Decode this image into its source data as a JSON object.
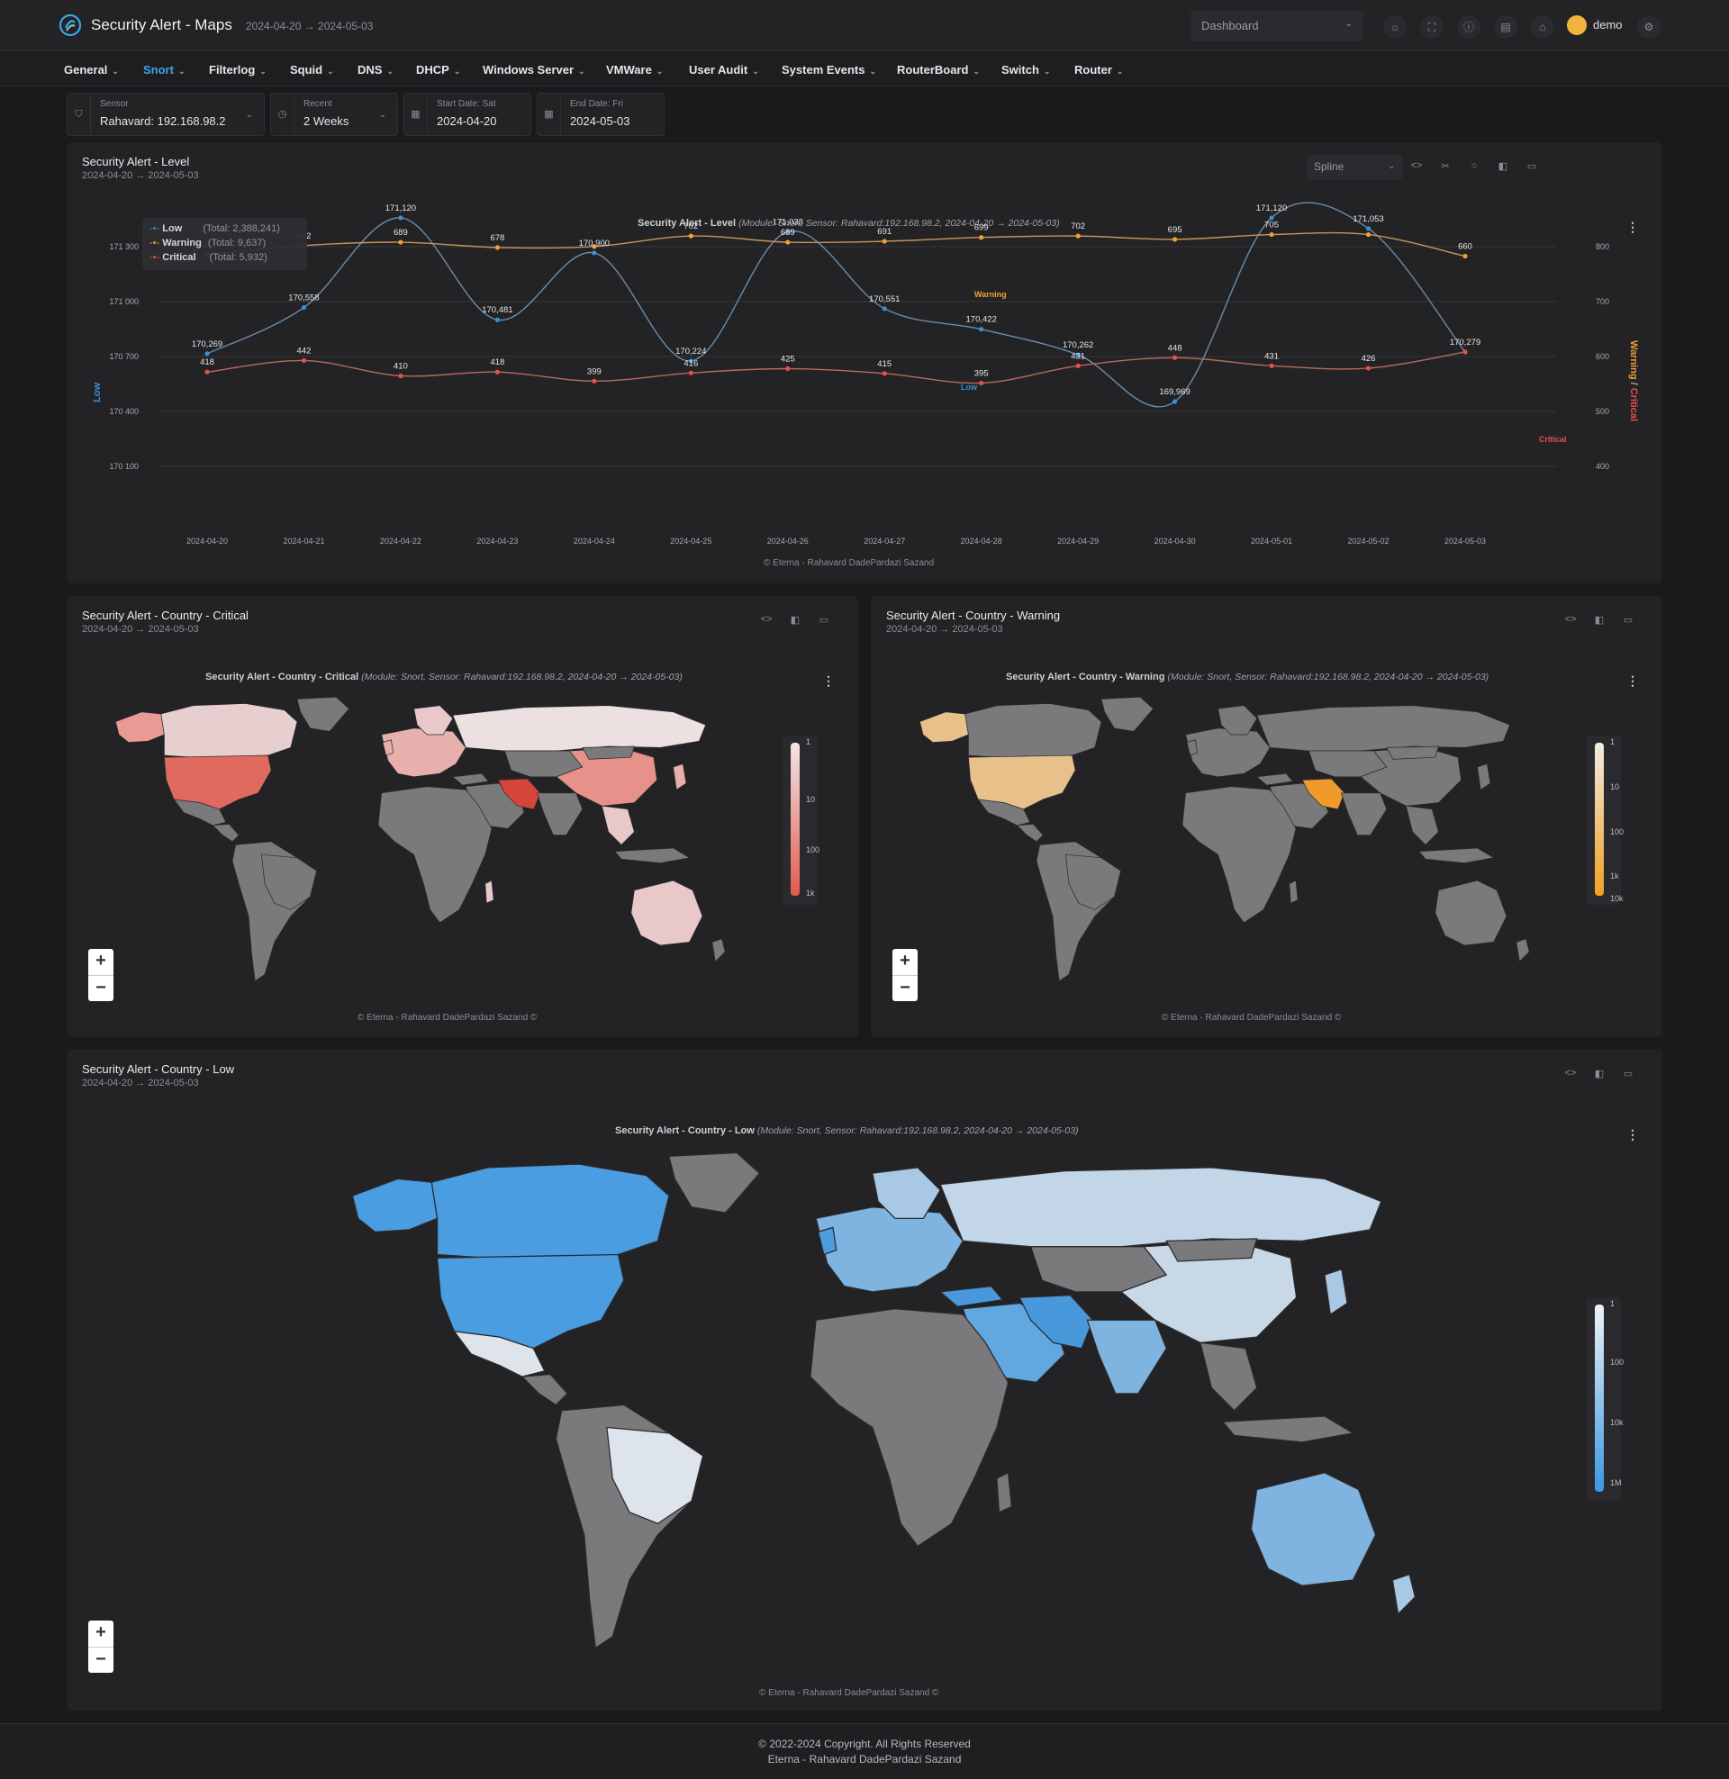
{
  "header": {
    "title": "Security Alert - Maps",
    "range": "2024-04-20 → 2024-05-03",
    "dashboard_select": "Dashboard",
    "user": "demo"
  },
  "nav": [
    {
      "label": "General"
    },
    {
      "label": "Snort"
    },
    {
      "label": "Filterlog"
    },
    {
      "label": "Squid"
    },
    {
      "label": "DNS"
    },
    {
      "label": "DHCP"
    },
    {
      "label": "Windows Server"
    },
    {
      "label": "VMWare"
    },
    {
      "label": "User Audit"
    },
    {
      "label": "System Events"
    },
    {
      "label": "RouterBoard"
    },
    {
      "label": "Switch"
    },
    {
      "label": "Router"
    }
  ],
  "filters": {
    "sensor": {
      "label": "Sensor",
      "value": "Rahavard: 192.168.98.2"
    },
    "recent": {
      "label": "Recent",
      "value": "2 Weeks"
    },
    "start": {
      "label": "Start Date: Sat",
      "value": "2024-04-20"
    },
    "end": {
      "label": "End Date: Fri",
      "value": "2024-05-03"
    }
  },
  "level_panel": {
    "title": "Security Alert - Level",
    "subtitle": "2024-04-20 → 2024-05-03",
    "chart_type_select": "Spline",
    "chart_title_bold": "Security Alert - Level",
    "chart_title_meta": "(Module: Snort, Sensor: Rahavard:192.168.98.2, 2024-04-20 → 2024-05-03)",
    "credit": "© Eterna - Rahavard DadePardazi Sazand"
  },
  "chart_data": {
    "type": "line",
    "title": "Security Alert - Level",
    "subtitle": "(Module: Snort, Sensor: Rahavard:192.168.98.2, 2024-04-20 → 2024-05-03)",
    "x": [
      "2024-04-20",
      "2024-04-21",
      "2024-04-22",
      "2024-04-23",
      "2024-04-24",
      "2024-04-25",
      "2024-04-26",
      "2024-04-27",
      "2024-04-28",
      "2024-04-29",
      "2024-04-30",
      "2024-05-01",
      "2024-05-02",
      "2024-05-03"
    ],
    "ylabel_left": "Low",
    "ylabel_right_a": "Warning",
    "ylabel_right_sep": " / ",
    "ylabel_right_b": "Critical",
    "y_left_ticks": [
      "171 300",
      "171 000",
      "170 700",
      "170 400",
      "170 100"
    ],
    "y_left_range": [
      169800,
      171300
    ],
    "y_right_ticks": [
      "800",
      "700",
      "600",
      "500",
      "400"
    ],
    "y_right_range": [
      300,
      800
    ],
    "series": [
      {
        "name": "Low",
        "total": "(Total: 2,388,241)",
        "color": "#3a8fd4",
        "axis": "left",
        "label": "Low",
        "values": [
          170269,
          170558,
          171120,
          170481,
          170900,
          170224,
          171033,
          170551,
          170422,
          170262,
          169969,
          171120,
          171053,
          170279
        ],
        "labels": [
          "170,269",
          "170,558",
          "171,120",
          "170,481",
          "170,900",
          "170,224",
          "171,033",
          "170,551",
          "170,422",
          "170,262",
          "169,969",
          "171,120",
          "171,053",
          "170,279"
        ]
      },
      {
        "name": "Warning",
        "total": "(Total: 9,637)",
        "color": "#f0a030",
        "axis": "right",
        "label": "Warning",
        "values": [
          663,
          682,
          689,
          678,
          680,
          702,
          689,
          691,
          699,
          702,
          695,
          705,
          705,
          660
        ],
        "labels": [
          "663",
          "682",
          "689",
          "678",
          "",
          "702",
          "689",
          "691",
          "699",
          "702",
          "695",
          "705",
          "",
          "660"
        ]
      },
      {
        "name": "Critical",
        "total": "(Total: 5,932)",
        "color": "#e8504a",
        "axis": "right",
        "label": "Critical",
        "values": [
          418,
          442,
          410,
          418,
          399,
          416,
          425,
          415,
          395,
          431,
          448,
          431,
          426,
          460
        ],
        "labels": [
          "418",
          "442",
          "410",
          "418",
          "399",
          "416",
          "425",
          "415",
          "395",
          "431",
          "448",
          "431",
          "426",
          ""
        ]
      }
    ]
  },
  "map_critical": {
    "title": "Security Alert - Country - Critical",
    "subtitle": "2024-04-20 → 2024-05-03",
    "chart_title_bold": "Security Alert - Country - Critical",
    "chart_title_meta": "(Module: Snort, Sensor: Rahavard:192.168.98.2, 2024-04-20 → 2024-05-03)",
    "legend_ticks": [
      "1",
      "10",
      "100",
      "1k"
    ],
    "legend_colors": [
      "#f2e6e6",
      "#e25a4e"
    ],
    "credit": "© Eterna - Rahavard DadePardazi Sazand ©"
  },
  "map_warning": {
    "title": "Security Alert - Country - Warning",
    "subtitle": "2024-04-20 → 2024-05-03",
    "chart_title_bold": "Security Alert - Country - Warning",
    "chart_title_meta": "(Module: Snort, Sensor: Rahavard:192.168.98.2, 2024-04-20 → 2024-05-03)",
    "legend_ticks": [
      "1",
      "10",
      "100",
      "1k",
      "10k"
    ],
    "legend_colors": [
      "#f2ece4",
      "#f0a020"
    ],
    "credit": "© Eterna - Rahavard DadePardazi Sazand ©"
  },
  "map_low": {
    "title": "Security Alert - Country - Low",
    "subtitle": "2024-04-20 → 2024-05-03",
    "chart_title_bold": "Security Alert - Country - Low",
    "chart_title_meta": "(Module: Snort, Sensor: Rahavard:192.168.98.2, 2024-04-20 → 2024-05-03)",
    "legend_ticks": [
      "1",
      "100",
      "10k",
      "1M"
    ],
    "legend_colors": [
      "#eef2f6",
      "#3a98e0"
    ],
    "credit": "© Eterna - Rahavard DadePardazi Sazand ©"
  },
  "footer": {
    "line1": "© 2022-2024 Copyright. All Rights Reserved",
    "line2": "Eterna - Rahavard DadePardazi Sazand"
  },
  "colors": {
    "land": "#7a7a7c",
    "ocean": "#232326",
    "accent": "#3aa8e8"
  }
}
